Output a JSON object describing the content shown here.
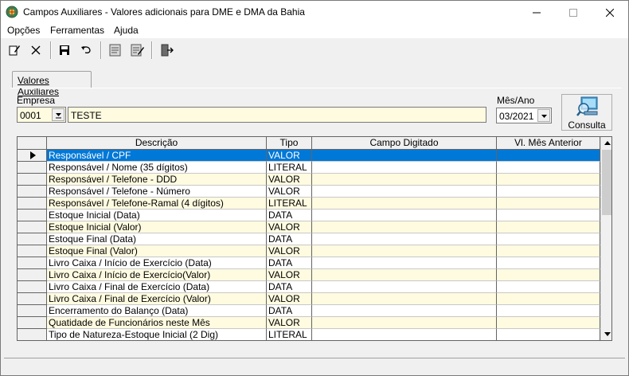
{
  "window": {
    "title": "Campos Auxiliares - Valores adicionais para DME e DMA da Bahia",
    "controls": {
      "minimize": "minimize-icon",
      "maximize": "maximize-icon",
      "close": "close-icon"
    }
  },
  "menu": {
    "items": [
      "Opções",
      "Ferramentas",
      "Ajuda"
    ]
  },
  "toolbar": {
    "buttons": [
      "edit-icon",
      "delete-icon",
      "save-icon",
      "undo-icon",
      "notes-icon",
      "edit-notes-icon",
      "exit-icon"
    ]
  },
  "tab": {
    "label": "Valores Auxiliares"
  },
  "empresa": {
    "label": "Empresa",
    "code": "0001",
    "name": "TESTE"
  },
  "mes_ano": {
    "label": "Mês/Ano",
    "value": "03/2021"
  },
  "consulta": {
    "label": "Consulta"
  },
  "grid": {
    "headers": [
      "Descrição",
      "Tipo",
      "Campo Digitado",
      "Vl. Mês Anterior"
    ],
    "rows": [
      {
        "descricao": "Responsável / CPF",
        "tipo": "VALOR",
        "campo": "",
        "anterior": ""
      },
      {
        "descricao": "Responsável / Nome (35 dígitos)",
        "tipo": "LITERAL",
        "campo": "",
        "anterior": ""
      },
      {
        "descricao": "Responsável / Telefone - DDD",
        "tipo": "VALOR",
        "campo": "",
        "anterior": ""
      },
      {
        "descricao": "Responsável / Telefone - Número",
        "tipo": "VALOR",
        "campo": "",
        "anterior": ""
      },
      {
        "descricao": "Responsável / Telefone-Ramal (4 dígitos)",
        "tipo": "LITERAL",
        "campo": "",
        "anterior": ""
      },
      {
        "descricao": "Estoque Inicial (Data)",
        "tipo": "DATA",
        "campo": "",
        "anterior": ""
      },
      {
        "descricao": "Estoque Inicial (Valor)",
        "tipo": "VALOR",
        "campo": "",
        "anterior": ""
      },
      {
        "descricao": "Estoque Final (Data)",
        "tipo": "DATA",
        "campo": "",
        "anterior": ""
      },
      {
        "descricao": "Estoque Final (Valor)",
        "tipo": "VALOR",
        "campo": "",
        "anterior": ""
      },
      {
        "descricao": "Livro Caixa / Início de Exercício (Data)",
        "tipo": "DATA",
        "campo": "",
        "anterior": ""
      },
      {
        "descricao": "Livro Caixa / Início de Exercício(Valor)",
        "tipo": "VALOR",
        "campo": "",
        "anterior": ""
      },
      {
        "descricao": "Livro Caixa / Final de Exercício (Data)",
        "tipo": "DATA",
        "campo": "",
        "anterior": ""
      },
      {
        "descricao": "Livro Caixa / Final de Exercício (Valor)",
        "tipo": "VALOR",
        "campo": "",
        "anterior": ""
      },
      {
        "descricao": "Encerramento do Balanço (Data)",
        "tipo": "DATA",
        "campo": "",
        "anterior": ""
      },
      {
        "descricao": "Quatidade de Funcionários neste Mês",
        "tipo": "VALOR",
        "campo": "",
        "anterior": ""
      },
      {
        "descricao": "Tipo de Natureza-Estoque Inicial (2 Dig)",
        "tipo": "LITERAL",
        "campo": "",
        "anterior": ""
      }
    ],
    "selected_row": 0
  },
  "colors": {
    "selection": "#0078d7",
    "field_bg": "#fffbe0"
  }
}
